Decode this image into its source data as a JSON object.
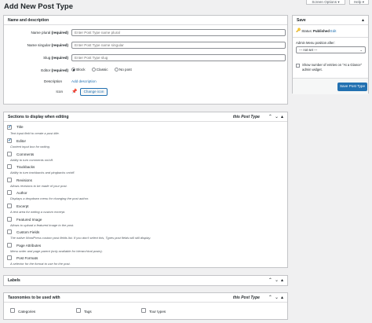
{
  "top_tabs": {
    "screen_options": "Screen Options ▾",
    "help": "Help ▾"
  },
  "page_title": "Add New Post Type",
  "name_box": {
    "title": "Name and description",
    "fields": [
      {
        "label": "Name plural",
        "required": "(required)",
        "placeholder": "Enter Post Type name plural"
      },
      {
        "label": "Name singular",
        "required": "(required)",
        "placeholder": "Enter Post Type name singular"
      },
      {
        "label": "Slug",
        "required": "(required)",
        "placeholder": "Enter Post Type slug"
      }
    ],
    "editor_label": "Editor",
    "editor_required": "(required)",
    "editor_options": [
      "Block",
      "Classic",
      "No post"
    ],
    "description_label": "Description",
    "add_description": "Add description",
    "icon_label": "Icon",
    "change_icon": "Change icon"
  },
  "save_box": {
    "title": "Save",
    "status_label": "Status:",
    "status_value": "Published",
    "edit_link": "Edit",
    "menu_position_label": "Admin Menu position after:",
    "menu_position_value": "--- not set ---",
    "glance_text": "Show number of entries on \"At a Glance\" admin widget.",
    "save_button": "Save Post Type"
  },
  "sections_box": {
    "title": "Sections to display when editing",
    "right_text": "this Post Type",
    "items": [
      {
        "label": "Title",
        "desc": "Text input field to create a post title.",
        "checked": true
      },
      {
        "label": "Editor",
        "desc": "Content input box for writing.",
        "checked": true
      },
      {
        "label": "Comments",
        "desc": "Ability to turn comments on/off.",
        "checked": false
      },
      {
        "label": "Trackbacks",
        "desc": "Ability to turn trackbacks and pingbacks on/off.",
        "checked": false
      },
      {
        "label": "Revisions",
        "desc": "Allows revisions to be made of your post.",
        "checked": false
      },
      {
        "label": "Author",
        "desc": "Displays a dropdown menu for changing the post author.",
        "checked": false
      },
      {
        "label": "Excerpt",
        "desc": "A text area for writing a custom excerpt.",
        "checked": false
      },
      {
        "label": "Featured Image",
        "desc": "Allows to upload a featured image to the post.",
        "checked": false
      },
      {
        "label": "Custom Fields",
        "desc": "The native WordPress custom post fields list. If you don't select this, Types post fields will still display.",
        "checked": false
      },
      {
        "label": "Page Attributes",
        "desc": "Menu order and page parent (only available for hierarchical posts).",
        "checked": false
      },
      {
        "label": "Post Formats",
        "desc": "A selector for the format to use for the post.",
        "checked": false
      }
    ]
  },
  "labels_box": {
    "title": "Labels"
  },
  "taxonomies_box": {
    "title": "Taxonomies to be used with",
    "right_text": "this Post Type",
    "items": [
      "Categories",
      "Tags",
      "Tour types"
    ]
  },
  "chevrons": {
    "up": "⌃",
    "down": "⌄",
    "caret": "▴"
  },
  "colors": {
    "accent": "#2271b1",
    "background": "#f0f0f1",
    "border": "#c3c4c7"
  }
}
